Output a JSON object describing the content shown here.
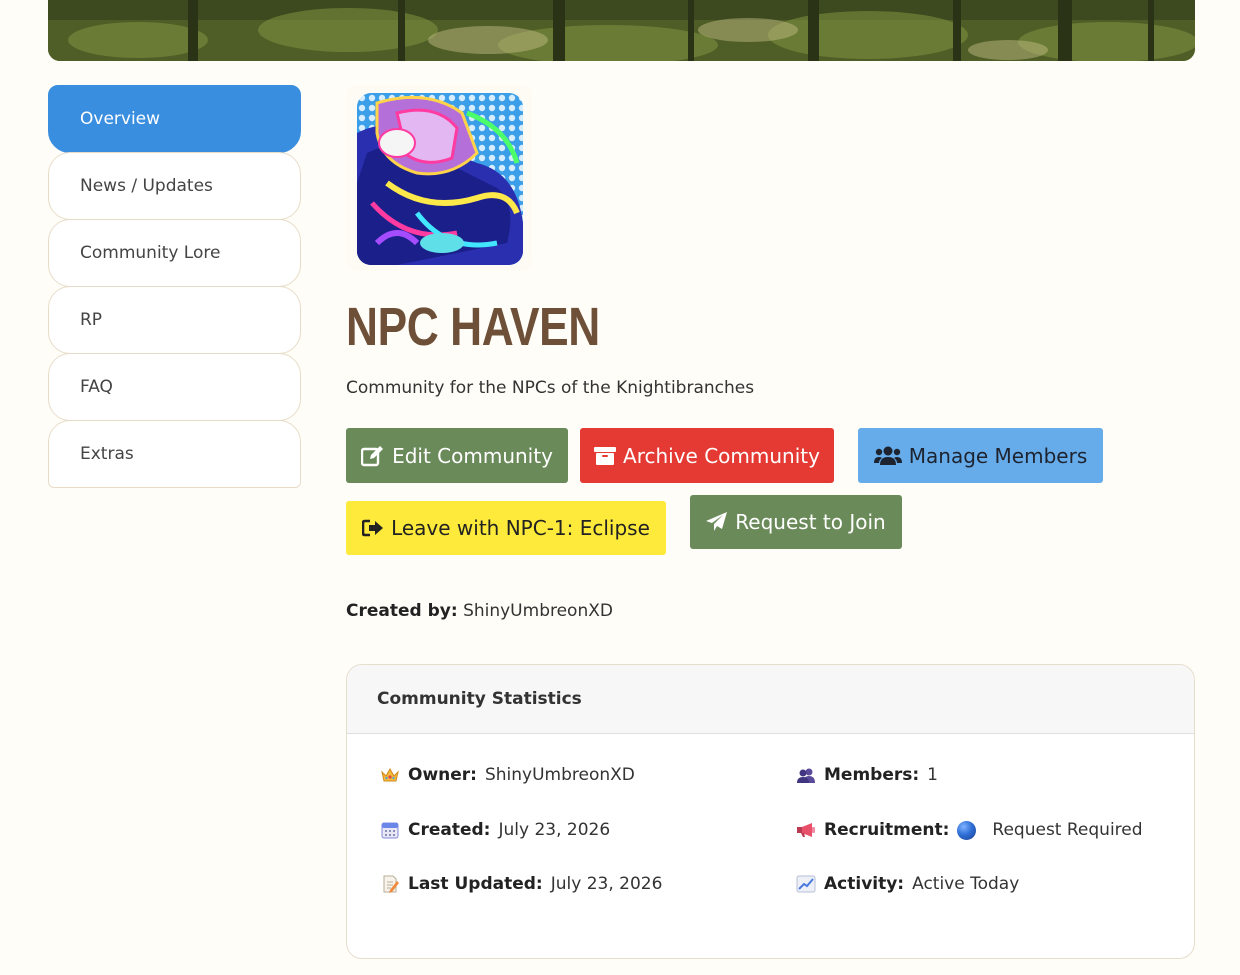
{
  "sidebar": {
    "items": [
      {
        "label": "Overview"
      },
      {
        "label": "News / Updates"
      },
      {
        "label": "Community Lore"
      },
      {
        "label": "RP"
      },
      {
        "label": "FAQ"
      },
      {
        "label": "Extras"
      }
    ]
  },
  "community": {
    "name": "NPC HAVEN",
    "description": "Community for the NPCs of the Knightibranches",
    "created_by_label": "Created by:",
    "created_by": "ShinyUmbreonXD"
  },
  "actions": {
    "edit": "Edit Community",
    "archive": "Archive Community",
    "manage": "Manage Members",
    "leave": "Leave with NPC-1: Eclipse",
    "join": "Request to Join"
  },
  "stats": {
    "title": "Community Statistics",
    "owner_label": "Owner:",
    "owner": "ShinyUmbreonXD",
    "created_label": "Created:",
    "created": "July 23, 2026",
    "updated_label": "Last Updated:",
    "updated": "July 23, 2026",
    "members_label": "Members:",
    "members": "1",
    "recruitment_label": "Recruitment:",
    "recruitment": "Request Required",
    "activity_label": "Activity:",
    "activity": "Active Today"
  },
  "colors": {
    "active_tab": "#3a8ee0",
    "title": "#6e4f38",
    "edit_button": "#6a8a59",
    "archive_button": "#e53a34",
    "manage_button": "#67acea",
    "leave_button": "#fdea3b",
    "join_button": "#6a8a59"
  },
  "icons": {
    "edit": "pencil-square-icon",
    "archive": "archive-box-icon",
    "manage": "users-icon",
    "leave": "sign-out-icon",
    "join": "paper-plane-icon",
    "owner": "crown-icon",
    "created": "calendar-icon",
    "updated": "memo-icon",
    "members": "busts-icon",
    "recruitment": "megaphone-icon",
    "activity": "chart-increasing-icon"
  }
}
